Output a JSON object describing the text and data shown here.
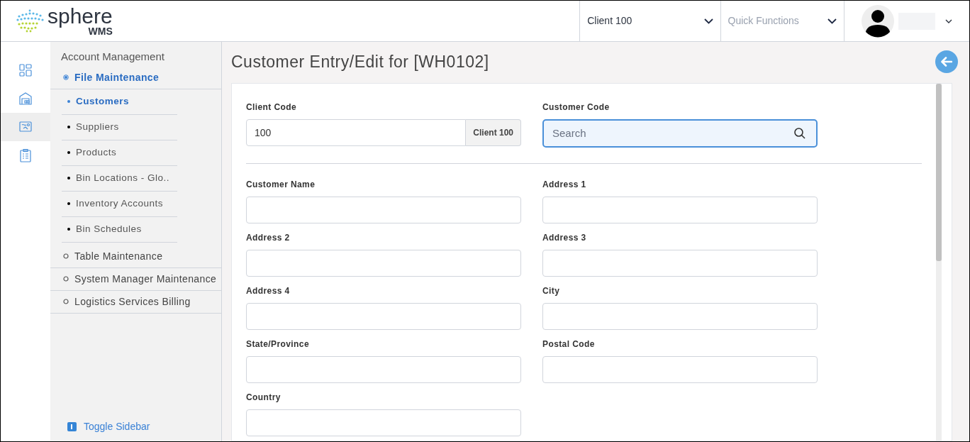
{
  "header": {
    "logo": {
      "name": "sphere",
      "subtitle": "WMS"
    },
    "client_select": {
      "value": "Client 100"
    },
    "quick_functions": {
      "placeholder": "Quick Functions"
    }
  },
  "icon_rail": [
    {
      "kind": "dashboard",
      "selected": false
    },
    {
      "kind": "warehouse",
      "selected": false
    },
    {
      "kind": "map",
      "selected": true
    },
    {
      "kind": "clipboard",
      "selected": false
    }
  ],
  "sidebar": {
    "title": "Account Management",
    "sections": [
      {
        "label": "File Maintenance",
        "expanded": true,
        "children": [
          {
            "label": "Customers",
            "selected": true
          },
          {
            "label": "Suppliers",
            "selected": false
          },
          {
            "label": "Products",
            "selected": false
          },
          {
            "label": "Bin Locations - Glo..",
            "selected": false
          },
          {
            "label": "Inventory Accounts",
            "selected": false
          },
          {
            "label": "Bin Schedules",
            "selected": false
          }
        ]
      },
      {
        "label": "Table Maintenance",
        "expanded": false
      },
      {
        "label": "System Manager Maintenance",
        "expanded": false
      },
      {
        "label": "Logistics Services Billing",
        "expanded": false
      }
    ],
    "toggle": "Toggle Sidebar"
  },
  "page": {
    "title": "Customer Entry/Edit for [WH0102]",
    "client_code": {
      "label": "Client Code",
      "value": "100",
      "addon": "Client 100"
    },
    "customer_code": {
      "label": "Customer Code",
      "placeholder": "Search",
      "focused": true
    },
    "fields": [
      {
        "label": "Customer Name"
      },
      {
        "label": "Address 1"
      },
      {
        "label": "Address 2"
      },
      {
        "label": "Address 3"
      },
      {
        "label": "Address 4"
      },
      {
        "label": "City"
      },
      {
        "label": "State/Province"
      },
      {
        "label": "Postal Code"
      },
      {
        "label": "Country"
      }
    ]
  }
}
